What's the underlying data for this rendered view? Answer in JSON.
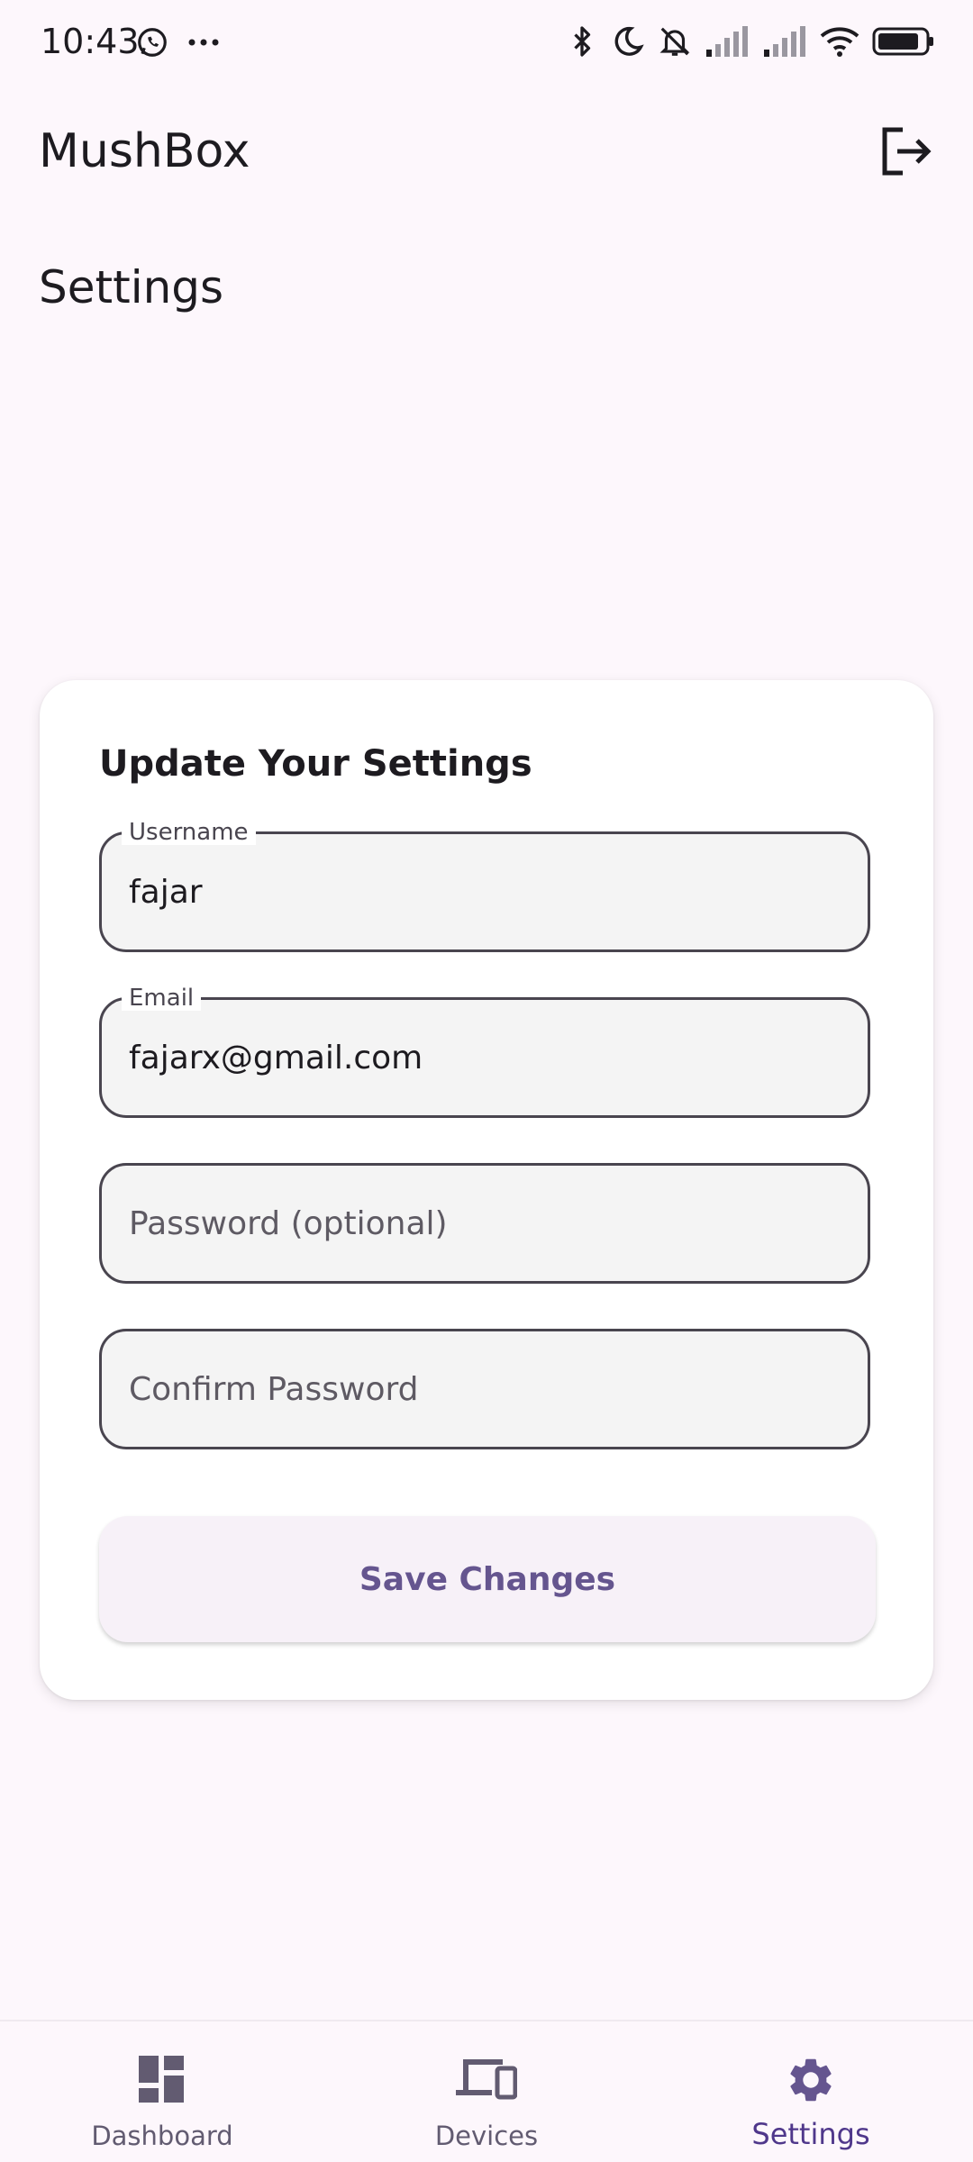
{
  "status_bar": {
    "time": "10:43"
  },
  "app_bar": {
    "title": "MushBox",
    "logout_icon": "logout-icon"
  },
  "page": {
    "heading": "Settings"
  },
  "form": {
    "title": "Update Your Settings",
    "username": {
      "label": "Username",
      "value": "fajar"
    },
    "email": {
      "label": "Email",
      "value": "fajarx@gmail.com"
    },
    "password": {
      "placeholder": "Password (optional)"
    },
    "confirm_password": {
      "placeholder": "Confirm Password"
    },
    "save_label": "Save Changes"
  },
  "bottom_nav": {
    "items": [
      {
        "label": "Dashboard",
        "icon": "dashboard-icon",
        "active": false
      },
      {
        "label": "Devices",
        "icon": "devices-icon",
        "active": false
      },
      {
        "label": "Settings",
        "icon": "gear-icon",
        "active": true
      }
    ]
  },
  "colors": {
    "background": "#FDF7FC",
    "accent": "#65558F",
    "active_nav": "#4F378B",
    "field_border": "#49454F"
  }
}
